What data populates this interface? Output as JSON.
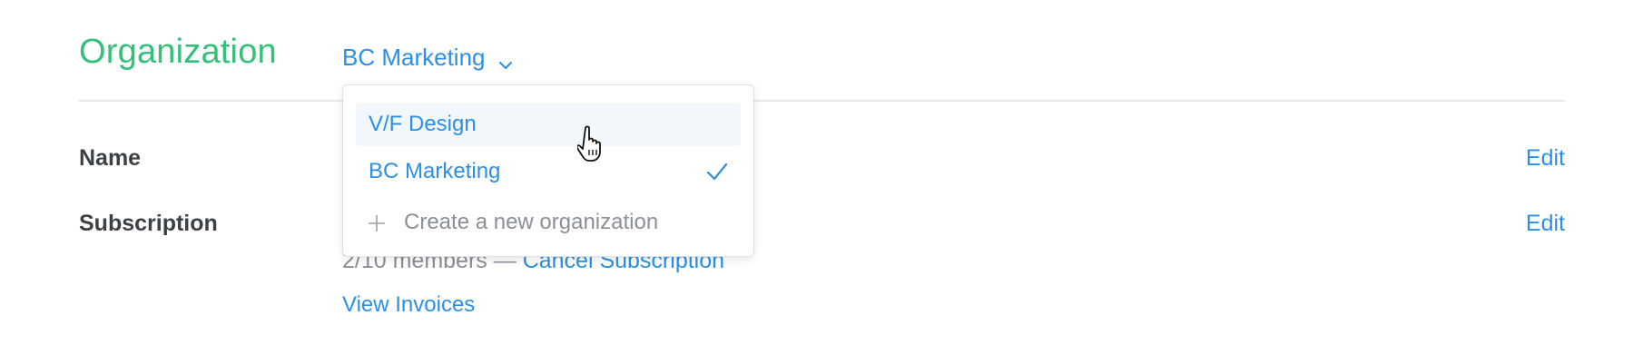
{
  "section": {
    "title": "Organization"
  },
  "org_switcher": {
    "current": "BC Marketing",
    "icon": "chevron-down-icon"
  },
  "rows": {
    "name": {
      "label": "Name",
      "edit": "Edit"
    },
    "subscription": {
      "label": "Subscription",
      "edit": "Edit",
      "members_text": "2/10 members — ",
      "cancel_link": "Cancel Subscription",
      "invoices_link": "View Invoices"
    }
  },
  "dropdown": {
    "items": [
      {
        "label": "V/F Design",
        "selected": false,
        "hovered": true
      },
      {
        "label": "BC Marketing",
        "selected": true,
        "hovered": false
      }
    ],
    "create_label": "Create a new organization",
    "check_icon": "checkmark-icon",
    "plus_icon": "plus-icon"
  },
  "colors": {
    "accent": "#2c8fe6",
    "section_title": "#35c07a",
    "muted": "#8a9096",
    "label": "#3c4145"
  }
}
